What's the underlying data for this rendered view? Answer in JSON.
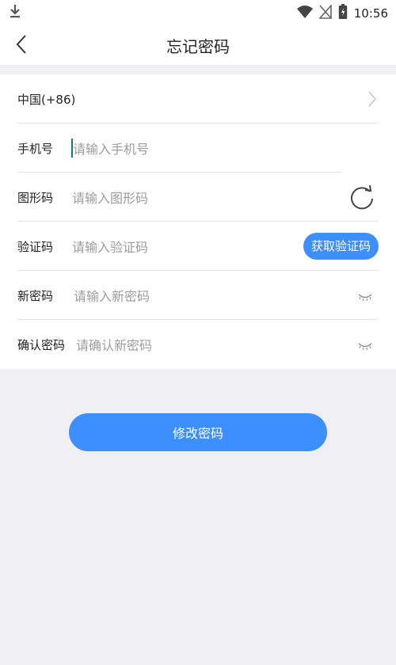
{
  "status_bar": {
    "time": "10:56",
    "icons": [
      "download-icon",
      "wifi-icon",
      "no-signal-icon",
      "battery-icon"
    ]
  },
  "header": {
    "title": "忘记密码",
    "back_icon": "chevron-left-icon"
  },
  "form": {
    "country": {
      "label": "中国(+86)"
    },
    "phone": {
      "label": "手机号",
      "placeholder": "请输入手机号"
    },
    "captcha": {
      "label": "图形码",
      "placeholder": "请输入图形码"
    },
    "verify_code": {
      "label": "验证码",
      "placeholder": "请输入验证码",
      "button": "获取验证码"
    },
    "new_password": {
      "label": "新密码",
      "placeholder": "请输入新密码"
    },
    "confirm_password": {
      "label": "确认密码",
      "placeholder": "请确认新密码"
    }
  },
  "submit_button": "修改密码",
  "colors": {
    "accent": "#3d8eff",
    "background": "#efeff4",
    "placeholder": "#9d9d9d"
  }
}
